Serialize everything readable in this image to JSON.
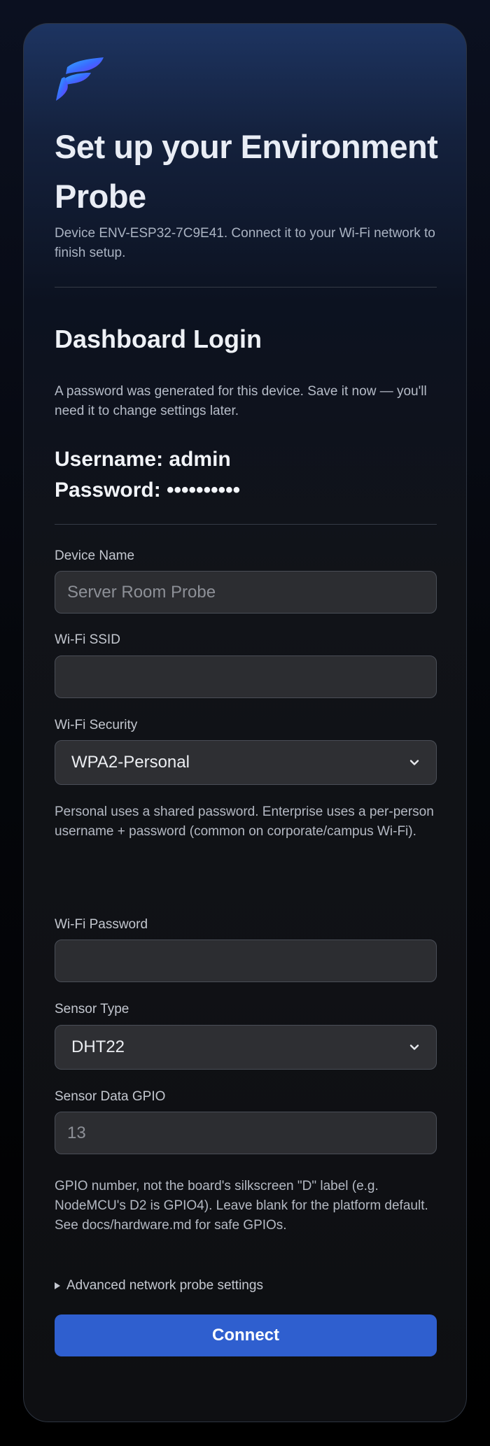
{
  "header": {
    "logo_icon": "feather-f-logo-icon",
    "title": "Set up your Environment Probe",
    "subtitle": "Device ENV-ESP32-7C9E41. Connect it to your Wi-Fi network to finish setup."
  },
  "login": {
    "title": "Dashboard Login",
    "note": "A password was generated for this device. Save it now — you'll need it to change settings later.",
    "username_line": "Username: admin",
    "password_line": "Password: ••••••••••"
  },
  "form": {
    "device_name": {
      "label": "Device Name",
      "placeholder": "Server Room Probe",
      "value": ""
    },
    "ssid": {
      "label": "Wi-Fi SSID",
      "placeholder": "",
      "value": ""
    },
    "security": {
      "label": "Wi-Fi Security",
      "selected": "WPA2-Personal",
      "help": "Personal uses a shared password. Enterprise uses a per-person username + password (common on corporate/campus Wi-Fi)."
    },
    "wifi_password": {
      "label": "Wi-Fi Password",
      "placeholder": "",
      "value": ""
    },
    "sensor_type": {
      "label": "Sensor Type",
      "selected": "DHT22"
    },
    "gpio": {
      "label": "Sensor Data GPIO",
      "placeholder": "13",
      "value": "",
      "help": "GPIO number, not the board's silkscreen \"D\" label (e.g. NodeMCU's D2 is GPIO4). Leave blank for the platform default. See docs/hardware.md for safe GPIOs."
    },
    "advanced_label": "Advanced network probe settings",
    "submit_label": "Connect"
  },
  "colors": {
    "accent": "#2f5fcf",
    "logo_top": "#5b8cff",
    "logo_bottom": "#7a2cff"
  }
}
